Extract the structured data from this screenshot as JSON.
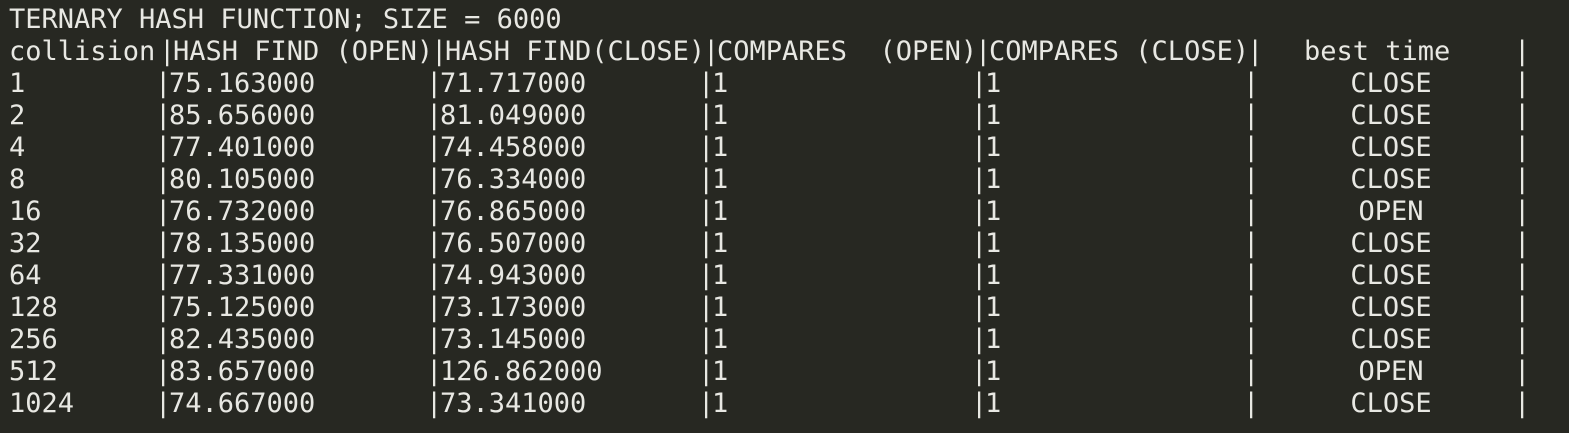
{
  "title": "TERNARY HASH FUNCTION; SIZE = 6000",
  "separator": "|",
  "headers": [
    "collision",
    "HASH FIND (OPEN)",
    "HASH FIND(CLOSE)",
    "COMPARES  (OPEN)",
    "COMPARES (CLOSE)",
    "best time"
  ],
  "rows": [
    {
      "collision": "1",
      "find_open": "75.163000",
      "find_close": "71.717000",
      "cmp_open": "1",
      "cmp_close": "1",
      "best": "CLOSE"
    },
    {
      "collision": "2",
      "find_open": "85.656000",
      "find_close": "81.049000",
      "cmp_open": "1",
      "cmp_close": "1",
      "best": "CLOSE"
    },
    {
      "collision": "4",
      "find_open": "77.401000",
      "find_close": "74.458000",
      "cmp_open": "1",
      "cmp_close": "1",
      "best": "CLOSE"
    },
    {
      "collision": "8",
      "find_open": "80.105000",
      "find_close": "76.334000",
      "cmp_open": "1",
      "cmp_close": "1",
      "best": "CLOSE"
    },
    {
      "collision": "16",
      "find_open": "76.732000",
      "find_close": "76.865000",
      "cmp_open": "1",
      "cmp_close": "1",
      "best": "OPEN"
    },
    {
      "collision": "32",
      "find_open": "78.135000",
      "find_close": "76.507000",
      "cmp_open": "1",
      "cmp_close": "1",
      "best": "CLOSE"
    },
    {
      "collision": "64",
      "find_open": "77.331000",
      "find_close": "74.943000",
      "cmp_open": "1",
      "cmp_close": "1",
      "best": "CLOSE"
    },
    {
      "collision": "128",
      "find_open": "75.125000",
      "find_close": "73.173000",
      "cmp_open": "1",
      "cmp_close": "1",
      "best": "CLOSE"
    },
    {
      "collision": "256",
      "find_open": "82.435000",
      "find_close": "73.145000",
      "cmp_open": "1",
      "cmp_close": "1",
      "best": "CLOSE"
    },
    {
      "collision": "512",
      "find_open": "83.657000",
      "find_close": "126.862000",
      "cmp_open": "1",
      "cmp_close": "1",
      "best": "OPEN"
    },
    {
      "collision": "1024",
      "find_open": "74.667000",
      "find_close": "73.341000",
      "cmp_open": "1",
      "cmp_close": "1",
      "best": "CLOSE"
    }
  ]
}
